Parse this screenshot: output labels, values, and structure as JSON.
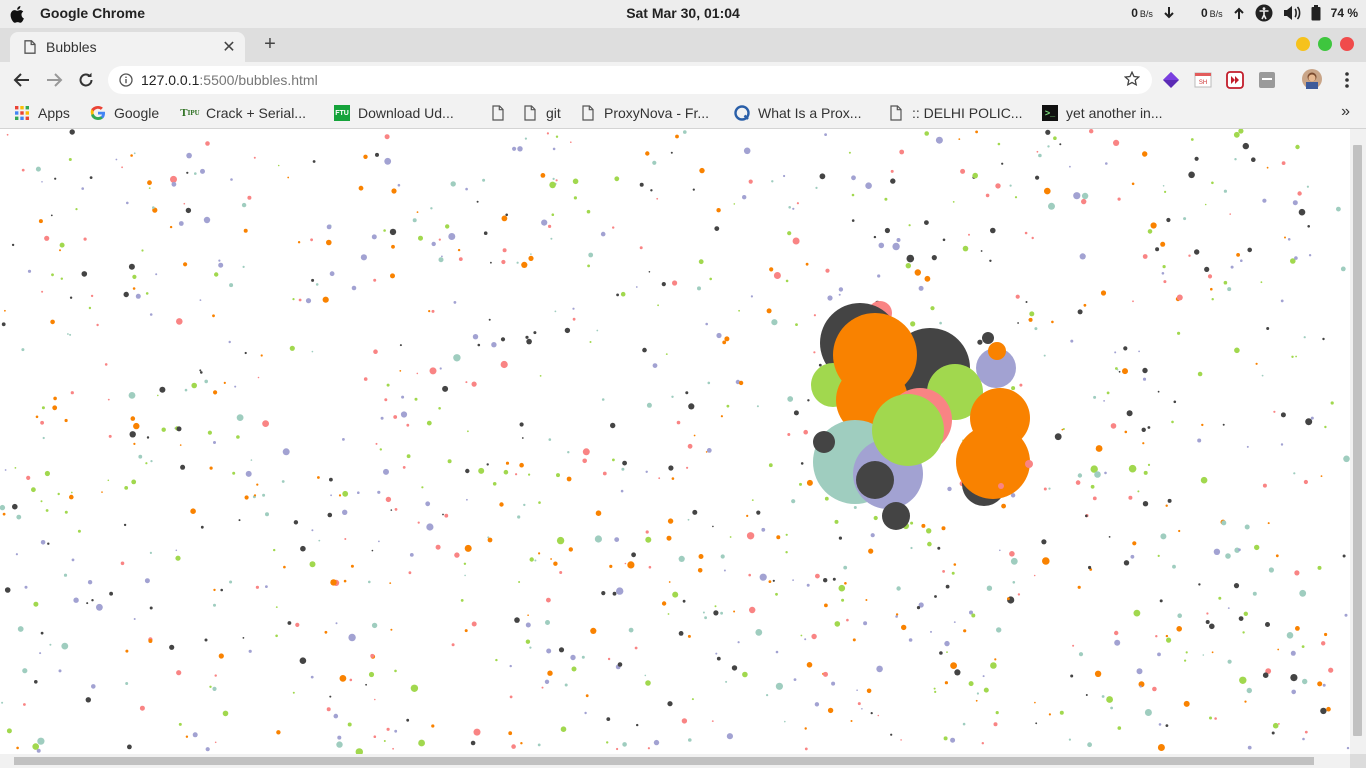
{
  "system_bar": {
    "app_name": "Google Chrome",
    "clock": "Sat Mar 30, 01:04",
    "net_down_value": "0",
    "net_down_unit": "B/s",
    "net_up_value": "0",
    "net_up_unit": "B/s",
    "battery": "74 %"
  },
  "browser": {
    "tab_title": "Bubbles",
    "url_host": "127.0.0.1",
    "url_path": ":5500/bubbles.html",
    "bookmarks": [
      {
        "label": "Apps",
        "icon": "apps-grid-icon"
      },
      {
        "label": "Google",
        "icon": "google-icon"
      },
      {
        "label": "Crack + Serial...",
        "icon": "tipu-icon"
      },
      {
        "label": "Download Ud...",
        "icon": "ftu-icon"
      },
      {
        "label": "",
        "icon": "page-icon"
      },
      {
        "label": "git",
        "icon": "page-icon"
      },
      {
        "label": "ProxyNova - Fr...",
        "icon": "page-icon"
      },
      {
        "label": "What Is a Prox...",
        "icon": "hosting-icon"
      },
      {
        "label": ":: DELHI POLIC...",
        "icon": "page-icon"
      },
      {
        "label": "yet another in...",
        "icon": "terminal-icon"
      }
    ]
  },
  "bubbles": {
    "palette": [
      "#444444",
      "#f98484",
      "#f98200",
      "#a2a2d2",
      "#9fcdbf",
      "#a1d84e"
    ]
  }
}
